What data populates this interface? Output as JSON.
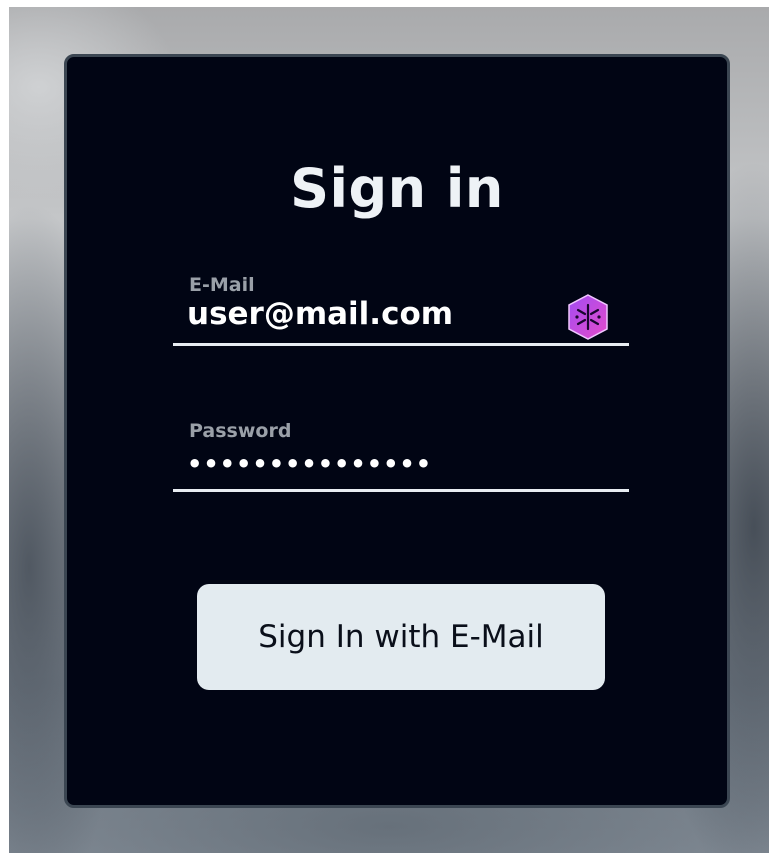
{
  "form": {
    "title": "Sign in",
    "email": {
      "label": "E-Mail",
      "value": "user@mail.com"
    },
    "password": {
      "label": "Password",
      "masked_value": "•••••••••••••••"
    },
    "submit_label": "Sign In with E-Mail",
    "extension_icon": "password-manager-icon"
  },
  "colors": {
    "card_background": "#010514",
    "card_border": "#3b4652",
    "button_background": "#e3ebf0",
    "label": "#9aa0a8",
    "text": "#ffffff",
    "icon_gradient_start": "#b04cf0",
    "icon_gradient_end": "#e24bd0"
  }
}
